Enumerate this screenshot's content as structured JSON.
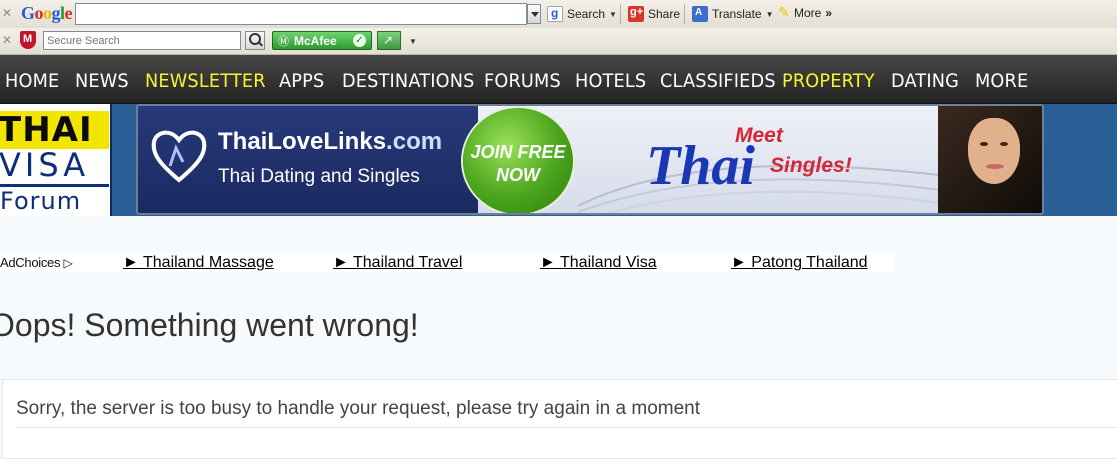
{
  "toolbar_google": {
    "logo_letters": [
      "G",
      "o",
      "o",
      "g",
      "l",
      "e"
    ],
    "search_value": "",
    "search_label": "Search",
    "share_label": "Share",
    "translate_label": "Translate",
    "more_label": "More"
  },
  "toolbar_mcafee": {
    "secure_search_placeholder": "Secure Search",
    "mcafee_label": "McAfee"
  },
  "nav": {
    "items": [
      {
        "label": "HOME"
      },
      {
        "label": "NEWS"
      },
      {
        "label": "NEWSLETTER"
      },
      {
        "label": "APPS"
      },
      {
        "label": "DESTINATIONS"
      },
      {
        "label": "FORUMS"
      },
      {
        "label": "HOTELS"
      },
      {
        "label": "CLASSIFIEDS"
      },
      {
        "label": "PROPERTY"
      },
      {
        "label": "DATING"
      },
      {
        "label": "MORE"
      }
    ],
    "highlight_color": "#f5f52e"
  },
  "site_logo": {
    "line1": "THAI",
    "line2": "VISA",
    "line3": "Forum"
  },
  "banner": {
    "site_name": "ThaiLoveLinks",
    "site_domain": ".com",
    "tagline": "Thai Dating and Singles",
    "join_line1": "JOIN FREE",
    "join_line2": "NOW",
    "meet": "Meet",
    "thai": "Thai",
    "singles": "Singles!"
  },
  "ad_links": {
    "adchoices": "AdChoices",
    "links": [
      {
        "label": "► Thailand Massage"
      },
      {
        "label": "► Thailand Travel"
      },
      {
        "label": "► Thailand Visa"
      },
      {
        "label": "► Patong Thailand"
      }
    ]
  },
  "error": {
    "title": "Oops! Something went wrong!",
    "message": "Sorry, the server is too busy to handle your request, please try again in a moment"
  }
}
